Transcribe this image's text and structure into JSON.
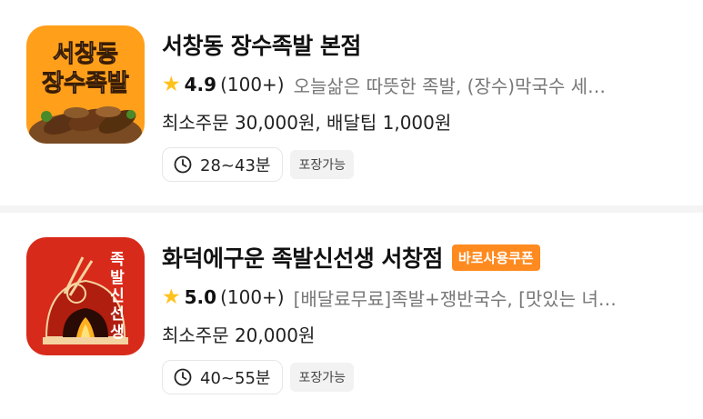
{
  "stores": [
    {
      "name": "서창동 장수족발 본점",
      "logo_text_line1": "서창동",
      "logo_text_line2": "장수족발",
      "rating": "4.9",
      "review_count": "(100+)",
      "description": "오늘삶은 따뜻한 족발, (장수)막국수 세…",
      "min_order": "최소주문 30,000원, 배달팁 1,000원",
      "delivery_time": "28~43분",
      "pickup_tag": "포장가능",
      "coupon": ""
    },
    {
      "name": "화덕에구운 족발신선생 서창점",
      "logo_text": "족발신선생",
      "rating": "5.0",
      "review_count": "(100+)",
      "description": "[배달료무료]족발+쟁반국수, [맛있는 녀…",
      "min_order": "최소주문 20,000원",
      "delivery_time": "40~55분",
      "pickup_tag": "포장가능",
      "coupon": "바로사용쿠폰"
    }
  ],
  "icons": {
    "star": "star-icon",
    "clock": "clock-icon"
  },
  "colors": {
    "star": "#ffc21c",
    "coupon_bg": "#ff8a1f",
    "logo1_bg": "#ff9f1a",
    "logo2_bg": "#d82a1a"
  }
}
